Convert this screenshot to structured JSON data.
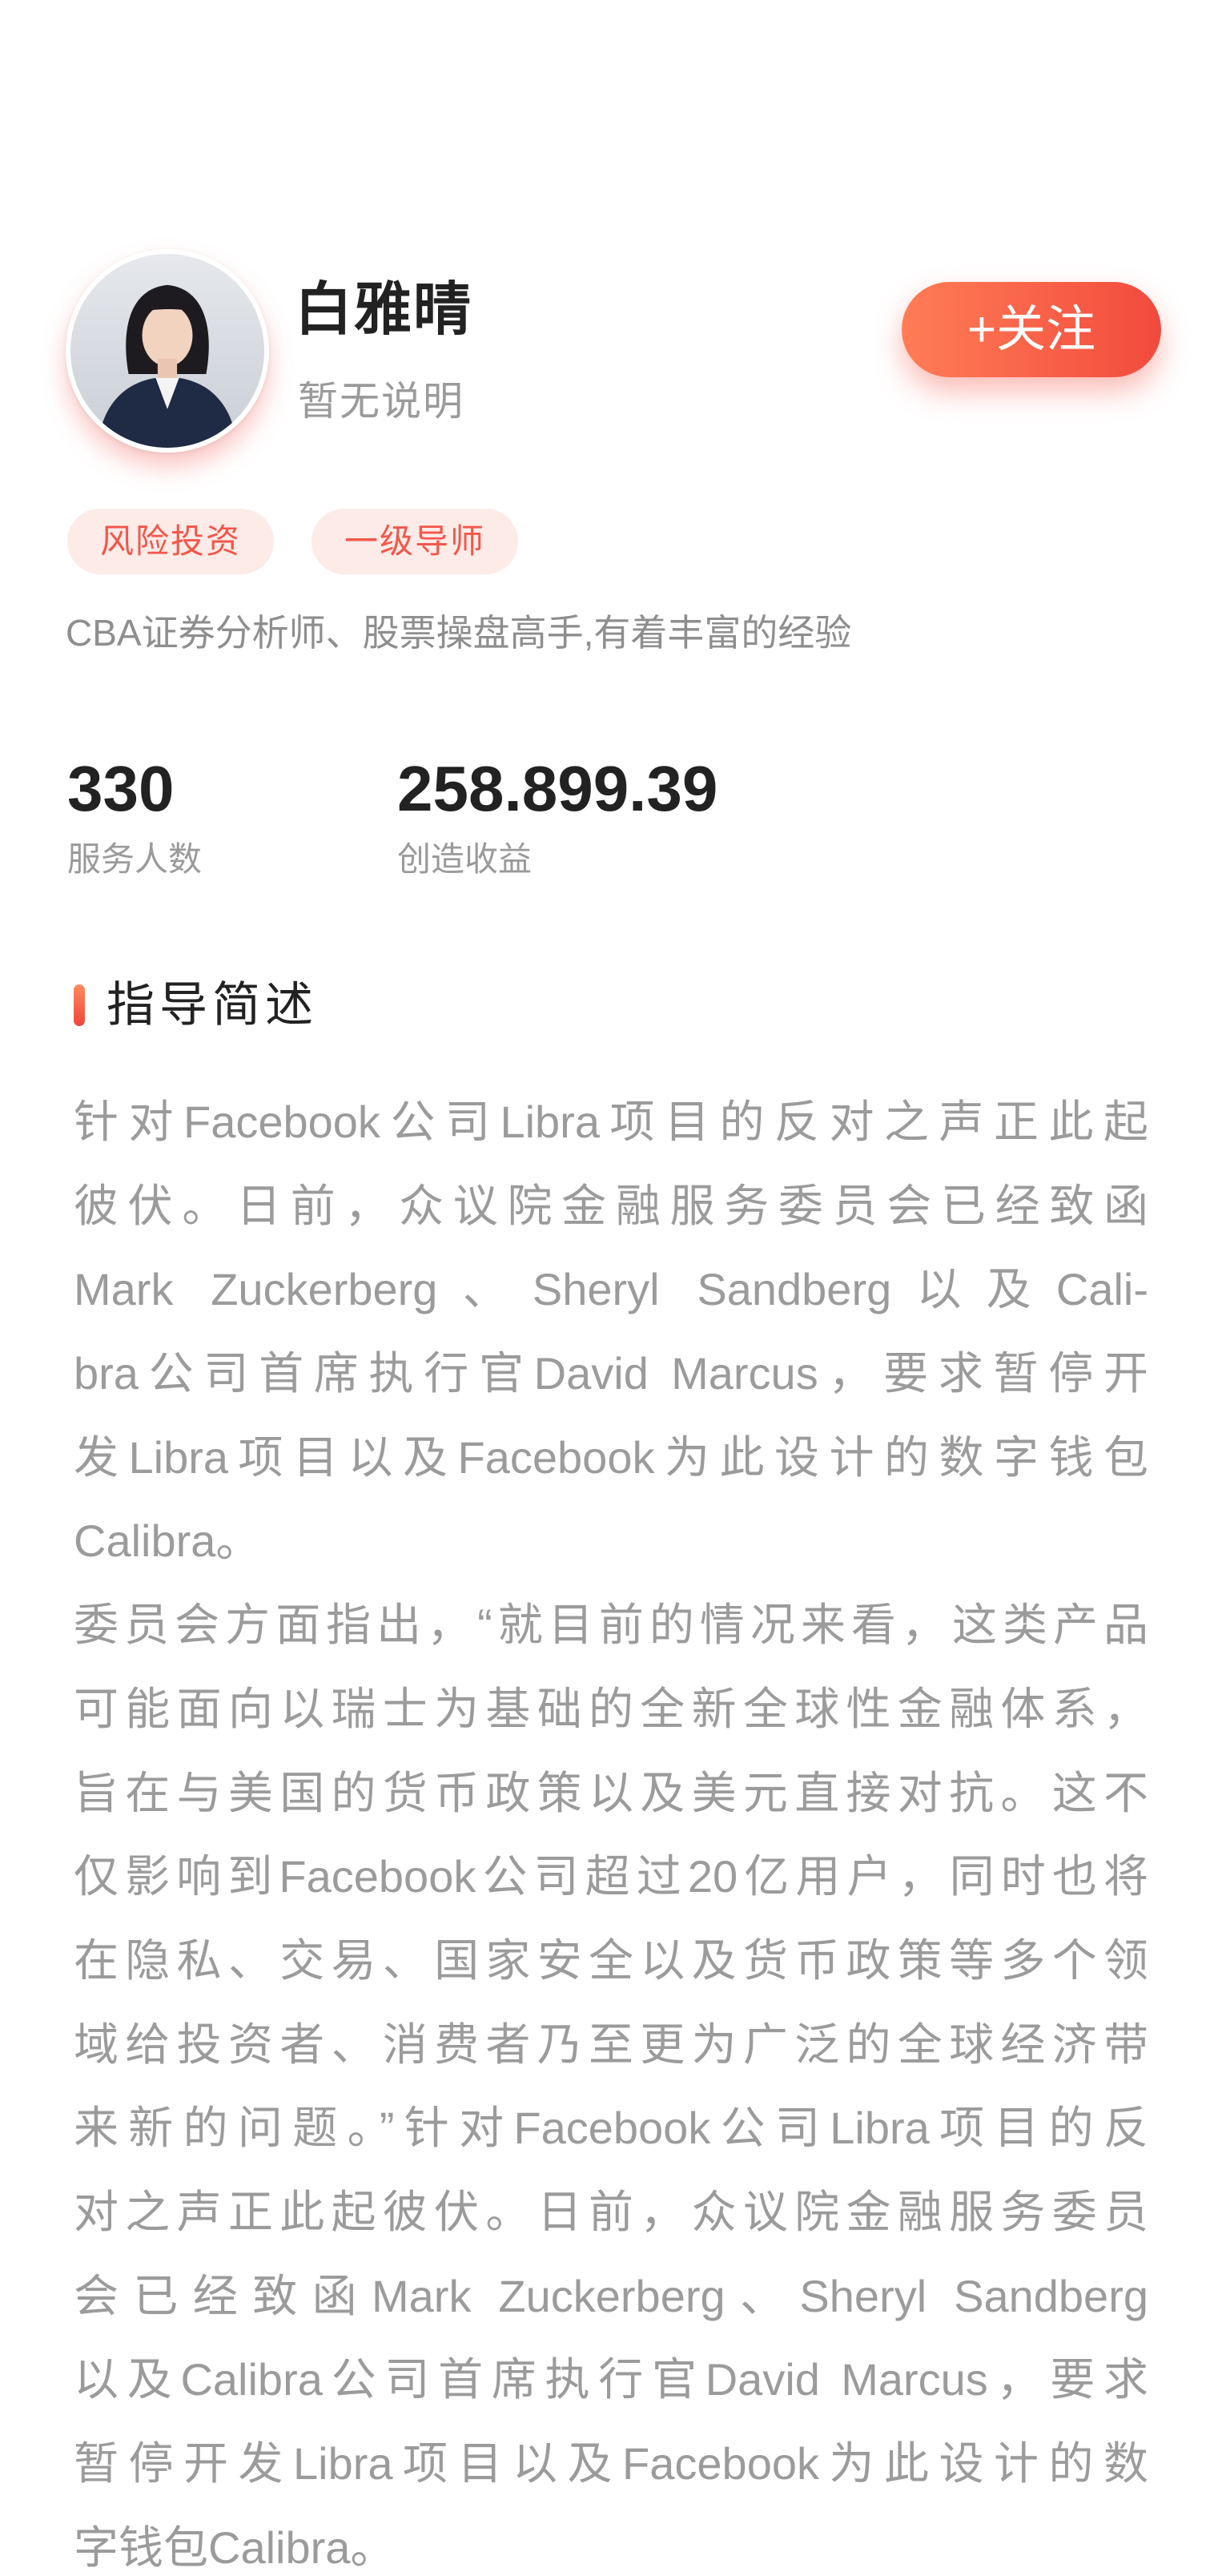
{
  "profile": {
    "name": "白雅晴",
    "subtitle": "暂无说明",
    "follow_label": "+关注",
    "tags": [
      "风险投资",
      "一级导师"
    ],
    "description": "CBA证券分析师、股票操盘高手,有着丰富的经验"
  },
  "stats": [
    {
      "value": "330",
      "label": "服务人数"
    },
    {
      "value": "258.899.39",
      "label": "创造收益"
    }
  ],
  "section": {
    "title": "指导简述",
    "lines": [
      "针对Facebook公司Libra项目的反对之声正此起",
      "彼伏。日前，众议院金融服务委员会已经致函",
      "Mark Zuckerberg、Sheryl Sandberg以及Cali-",
      "bra公司首席执行官David Marcus，要求暂停开",
      "发Libra项目以及Facebook为此设计的数字钱包",
      "Calibra。",
      "委员会方面指出，“就目前的情况来看，这类产品",
      "可能面向以瑞士为基础的全新全球性金融体系，",
      "旨在与美国的货币政策以及美元直接对抗。这不",
      "仅影响到Facebook公司超过20亿用户，同时也将",
      "在隐私、交易、国家安全以及货币政策等多个领",
      "域给投资者、消费者乃至更为广泛的全球经济带",
      "来新的问题。”针对Facebook公司Libra项目的反",
      "对之声正此起彼伏。日前，众议院金融服务委员",
      "会已经致函Mark Zuckerberg、Sheryl Sandberg",
      "以及Calibra公司首席执行官David Marcus，要求",
      "暂停开发Libra项目以及Facebook为此设计的数",
      "字钱包Calibra。"
    ]
  },
  "colors": {
    "accent_start": "#ff7d55",
    "accent_end": "#f24a3e",
    "tag_bg": "#fdebe8",
    "tag_text": "#f2574a",
    "title_text": "#222222",
    "muted_text": "#9a9a9a"
  }
}
